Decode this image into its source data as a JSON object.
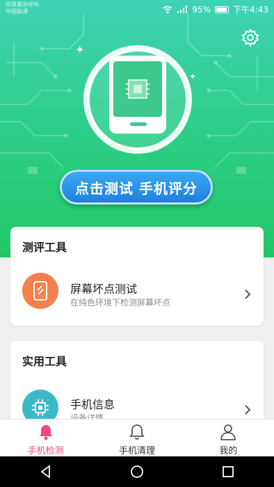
{
  "status_bar": {
    "line1": "仅限紧急呼叫",
    "line2": "中国联通",
    "battery": "95%",
    "time": "下午4:43"
  },
  "hero": {
    "test_button_label": "点击测试 手机评分"
  },
  "evaluation_tools": {
    "title": "测评工具",
    "items": [
      {
        "title": "屏幕坏点测试",
        "subtitle": "在纯色环境下检测屏幕坏点",
        "icon": "phone-screen-icon",
        "color": "#f4804c"
      }
    ]
  },
  "utility_tools": {
    "title": "实用工具",
    "items": [
      {
        "title": "手机信息",
        "subtitle": "设备详情",
        "icon": "chip-icon",
        "color": "#3bbac6"
      }
    ]
  },
  "bottom_nav": {
    "items": [
      {
        "label": "手机检测",
        "icon": "bell-filled-icon",
        "active": true
      },
      {
        "label": "手机清理",
        "icon": "bell-outline-icon",
        "active": false
      },
      {
        "label": "我的",
        "icon": "person-icon",
        "active": false
      }
    ]
  },
  "colors": {
    "accent_pink": "#ef4a87",
    "hero_green": "#21c765",
    "button_blue": "#1f7fdc"
  }
}
